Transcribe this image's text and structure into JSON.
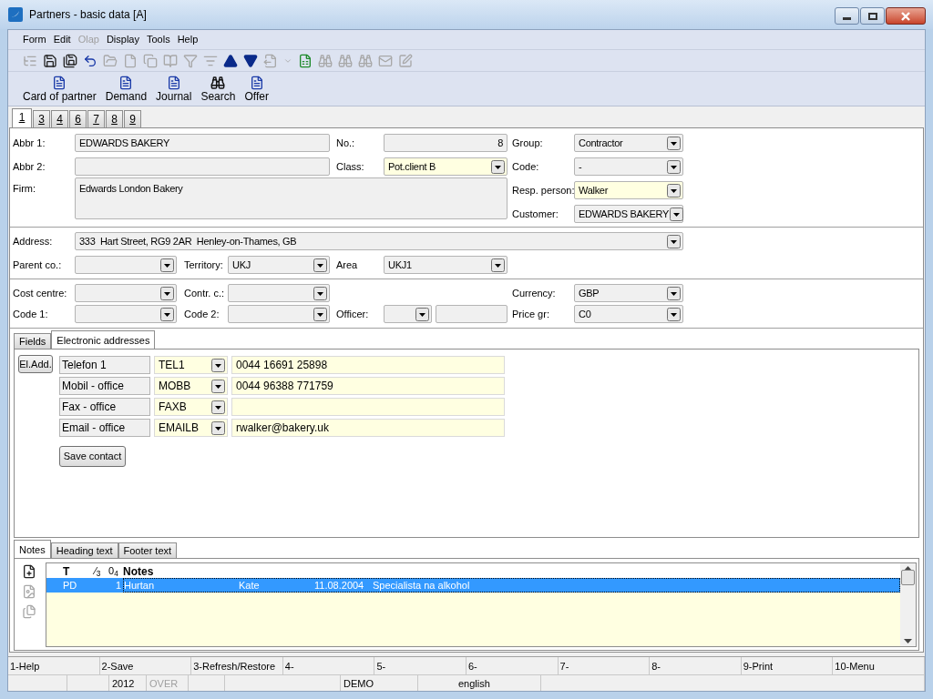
{
  "window": {
    "title": "Partners - basic data [A]"
  },
  "menu": [
    {
      "label": "Form",
      "disabled": false
    },
    {
      "label": "Edit",
      "disabled": false
    },
    {
      "label": "Olap",
      "disabled": true
    },
    {
      "label": "Display",
      "disabled": false
    },
    {
      "label": "Tools",
      "disabled": false
    },
    {
      "label": "Help",
      "disabled": false
    }
  ],
  "toolbar": [
    {
      "kind": "tree",
      "disabled": true
    },
    {
      "kind": "save",
      "disabled": false
    },
    {
      "kind": "save-as",
      "disabled": false
    },
    {
      "kind": "undo",
      "disabled": false
    },
    {
      "kind": "open",
      "disabled": true
    },
    {
      "kind": "new",
      "disabled": true
    },
    {
      "kind": "copy",
      "disabled": true
    },
    {
      "kind": "book",
      "disabled": true
    },
    {
      "kind": "filter",
      "disabled": true
    },
    {
      "kind": "filter-list",
      "disabled": true
    },
    {
      "kind": "up",
      "disabled": false
    },
    {
      "kind": "down",
      "disabled": false
    },
    {
      "kind": "export",
      "disabled": true
    },
    {
      "kind": "dropdown",
      "disabled": true
    },
    {
      "kind": "excel",
      "disabled": false
    },
    {
      "kind": "find",
      "disabled": true
    },
    {
      "kind": "find-next",
      "disabled": true
    },
    {
      "kind": "find-prev",
      "disabled": true
    },
    {
      "kind": "mail",
      "disabled": true
    },
    {
      "kind": "edit",
      "disabled": true
    }
  ],
  "actions": [
    {
      "label": "Card of partner",
      "kind": "document"
    },
    {
      "label": "Demand",
      "kind": "document"
    },
    {
      "label": "Journal",
      "kind": "document"
    },
    {
      "label": "Search",
      "kind": "search"
    },
    {
      "label": "Offer",
      "kind": "document"
    }
  ],
  "page_tabs": [
    {
      "label": "1",
      "selected": true
    },
    {
      "label": "3",
      "selected": false
    },
    {
      "label": "4",
      "selected": false
    },
    {
      "label": "6",
      "selected": false
    },
    {
      "label": "7",
      "selected": false
    },
    {
      "label": "8",
      "selected": false
    },
    {
      "label": "9",
      "selected": false
    }
  ],
  "form": {
    "abbr1": {
      "label": "Abbr 1:",
      "value": "EDWARDS BAKERY",
      "kind": "text",
      "highlighted": false
    },
    "no": {
      "label": "No.:",
      "value": "8",
      "kind": "text",
      "highlighted": false
    },
    "group": {
      "label": "Group:",
      "value": "Contractor",
      "kind": "combo",
      "highlighted": false
    },
    "abbr2": {
      "label": "Abbr 2:",
      "kind": "text",
      "highlighted": false
    },
    "class": {
      "label": "Class:",
      "value": "Pot.client B",
      "kind": "combo",
      "highlighted": true
    },
    "code": {
      "label": "Code:",
      "value": "-",
      "kind": "combo",
      "highlighted": false
    },
    "firm": {
      "label": "Firm:",
      "value": "Edwards London Bakery",
      "kind": "text",
      "highlighted": false
    },
    "resp_person": {
      "label": "Resp. person:",
      "value": "Walker",
      "kind": "combo",
      "highlighted": true
    },
    "customer": {
      "label": "Customer:",
      "value": "EDWARDS BAKERY",
      "kind": "combo",
      "highlighted": false
    },
    "address": {
      "label": "Address:",
      "value": "333  Hart Street, RG9 2AR  Henley-on-Thames, GB",
      "kind": "combo",
      "highlighted": false
    },
    "parent_co": {
      "label": "Parent co.:",
      "kind": "combo",
      "highlighted": false
    },
    "territory": {
      "label": "Territory:",
      "value": "UKJ",
      "kind": "combo",
      "highlighted": false
    },
    "area": {
      "label": "Area",
      "value": "UKJ1",
      "kind": "combo",
      "highlighted": false
    },
    "cost_centre": {
      "label": "Cost centre:",
      "kind": "combo",
      "highlighted": false
    },
    "contr_c": {
      "label": "Contr. c.:",
      "kind": "combo",
      "highlighted": false
    },
    "currency": {
      "label": "Currency:",
      "value": "GBP",
      "kind": "combo",
      "highlighted": false
    },
    "code1": {
      "label": "Code 1:",
      "kind": "combo",
      "highlighted": false
    },
    "code2": {
      "label": "Code 2:",
      "kind": "combo",
      "highlighted": false
    },
    "officer": {
      "label": "Officer:",
      "kind": "combo",
      "highlighted": false
    },
    "officer_name": {
      "kind": "text",
      "highlighted": false
    },
    "price_gr": {
      "label": "Price gr:",
      "value": "C0",
      "kind": "combo",
      "highlighted": false
    }
  },
  "sub_tabs": [
    {
      "label": "Fields",
      "selected": false
    },
    {
      "label": "Electronic addresses",
      "selected": true
    }
  ],
  "electronic_addresses": {
    "add_button": "El.Add.",
    "rows": [
      {
        "name": "Telefon 1",
        "type": "TEL1",
        "value": "0044 16691 25898"
      },
      {
        "name": "Mobil - office",
        "type": "MOBB",
        "value": "0044 96388 771759"
      },
      {
        "name": "Fax - office",
        "type": "FAXB"
      },
      {
        "name": "Email - office",
        "type": "EMAILB",
        "value": "rwalker@bakery.uk"
      }
    ],
    "save_button": "Save contact"
  },
  "notes_tabs": [
    {
      "label": "Notes",
      "selected": true
    },
    {
      "label": "Heading text",
      "selected": false
    },
    {
      "label": "Footer text",
      "selected": false
    }
  ],
  "note_tools": [
    {
      "disabled": false
    },
    {
      "disabled": true
    },
    {
      "disabled": true
    }
  ],
  "notes_table": {
    "columns": [
      "T",
      "⁄$_{3}$",
      "0$_{4}$",
      "Notes"
    ],
    "rows": [
      {
        "type": "PD",
        "number": "1",
        "surname": "Hurtan",
        "first_name": "Kate",
        "date": "11.08.2004",
        "note": "Specialista na alkohol",
        "selected": true
      }
    ]
  },
  "function_keys": [
    "1-Help",
    "2-Save",
    "3-Refresh/Restore",
    "4-",
    "5-",
    "6-",
    "7-",
    "8-",
    "9-Print",
    "10-Menu"
  ],
  "status_bar": [
    {
      "text": "2012",
      "disabled": false
    },
    {
      "text": "OVER",
      "disabled": true
    },
    {
      "text": "DEMO",
      "disabled": false
    },
    {
      "text": "english",
      "disabled": false
    }
  ]
}
